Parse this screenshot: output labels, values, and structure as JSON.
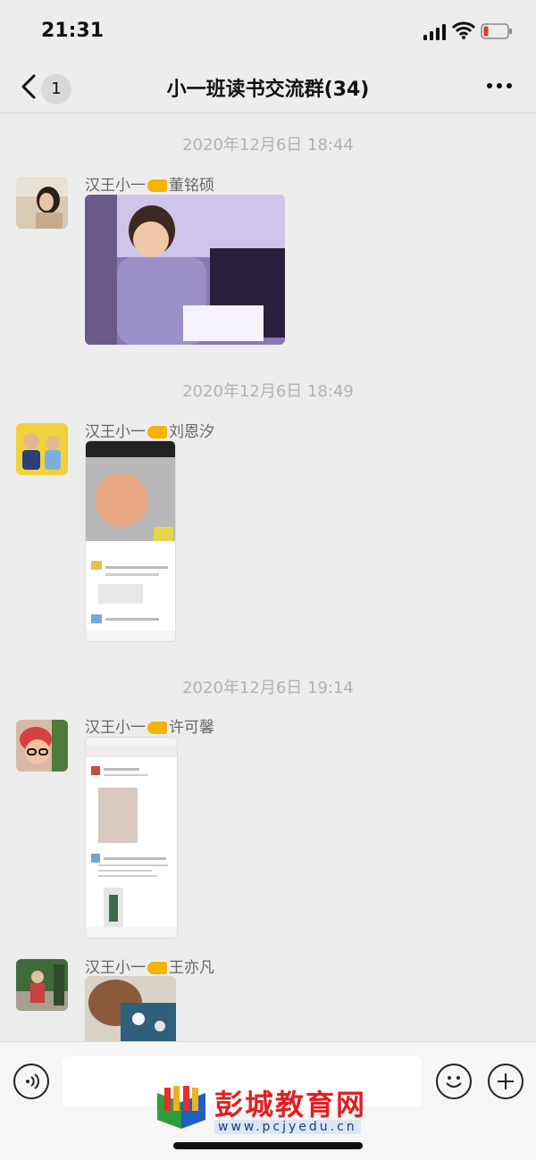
{
  "status_bar": {
    "time": "21:31"
  },
  "nav": {
    "back_count": "1",
    "title": "小一班读书交流群(34)"
  },
  "messages": [
    {
      "timestamp": "2020年12月6日 18:44",
      "sender": "汉王小一",
      "sender_name": "董铭硕"
    },
    {
      "timestamp": "2020年12月6日 18:49",
      "sender": "汉王小一",
      "sender_name": "刘恩汐"
    },
    {
      "timestamp": "2020年12月6日 19:14",
      "sender": "汉王小一",
      "sender_name": "许可馨"
    },
    {
      "sender": "汉王小一",
      "sender_name": "王亦凡"
    }
  ],
  "icons": {
    "back": "chevron-left-icon",
    "more": "more-dots-icon",
    "voice": "voice-icon",
    "emoji": "emoji-icon",
    "plus": "plus-icon"
  },
  "watermark": {
    "name": "彭城教育网",
    "url": "www.pcjyedu.cn"
  },
  "colors": {
    "background": "#ededed",
    "watermark_red": "#e02020",
    "watermark_blue": "#1a3a8a"
  }
}
